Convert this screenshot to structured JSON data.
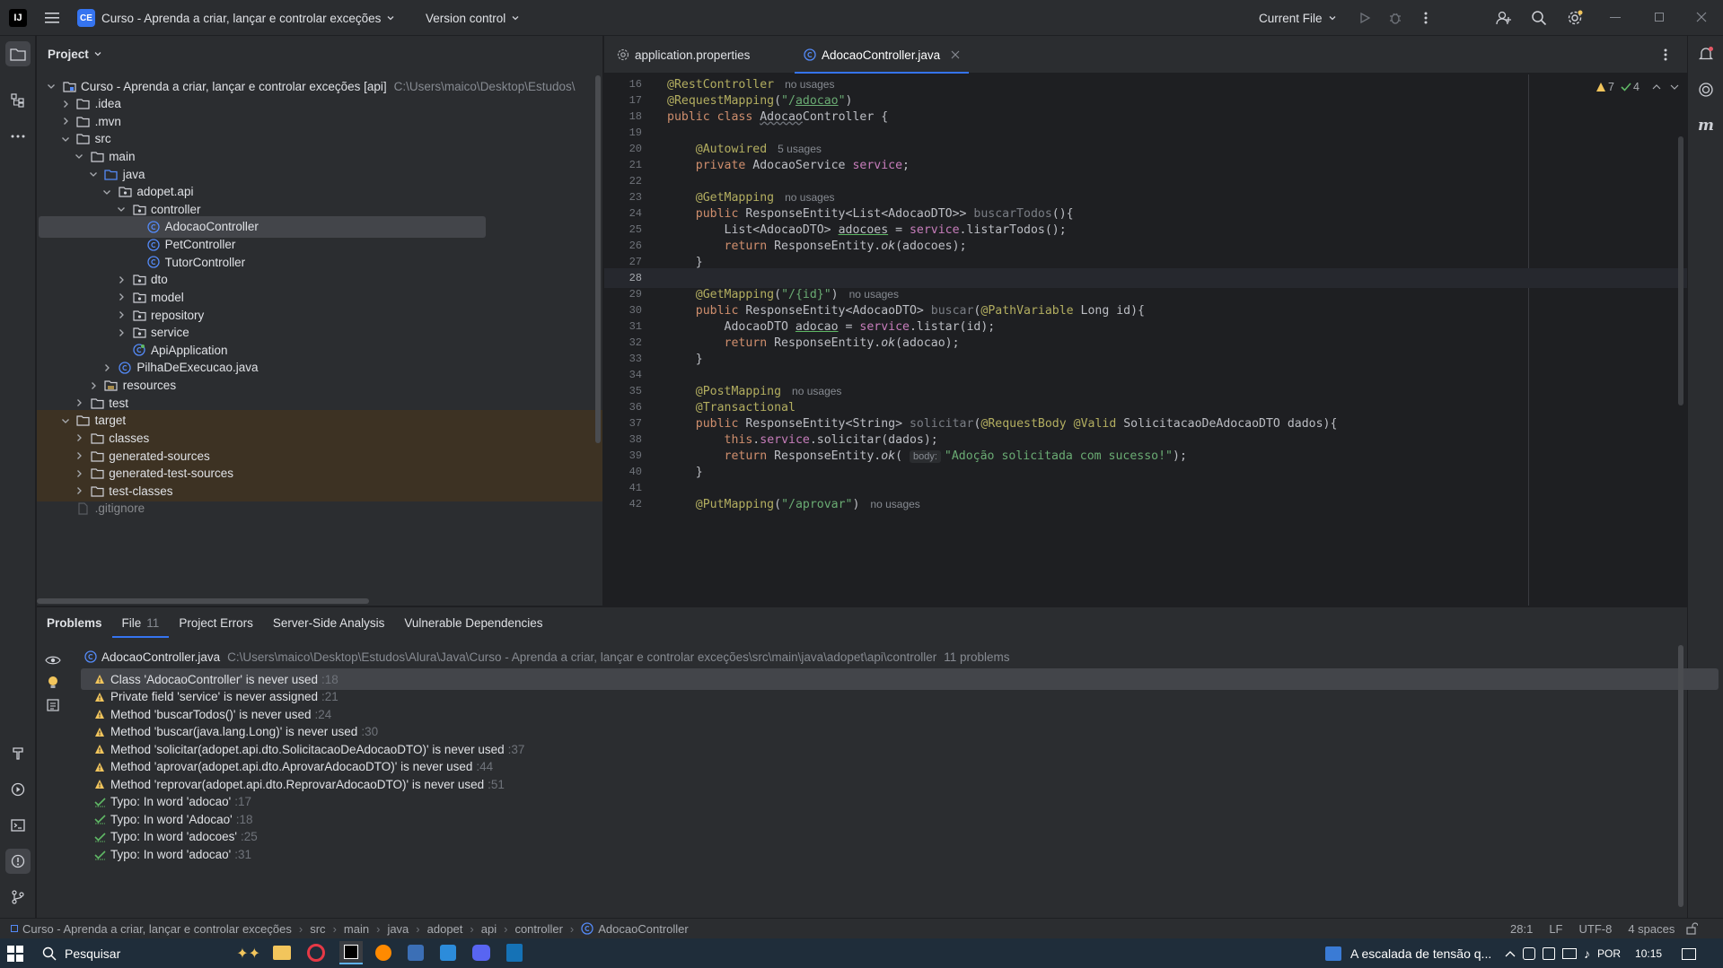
{
  "title_bar": {
    "project_badge": "CE",
    "project_name": "Curso - Aprenda a criar, lançar e controlar exceções",
    "vcs": "Version control",
    "run_config": "Current File"
  },
  "project_panel": {
    "title": "Project",
    "tree": [
      {
        "label": "Curso - Aprenda a criar, lançar e controlar exceções [api]",
        "path": "C:\\Users\\maico\\Desktop\\Estudos\\",
        "indent": 0,
        "type": "module",
        "chev": "down"
      },
      {
        "label": ".idea",
        "indent": 1,
        "type": "folder",
        "chev": "right"
      },
      {
        "label": ".mvn",
        "indent": 1,
        "type": "folder",
        "chev": "right"
      },
      {
        "label": "src",
        "indent": 1,
        "type": "folder",
        "chev": "down"
      },
      {
        "label": "main",
        "indent": 2,
        "type": "folder",
        "chev": "down"
      },
      {
        "label": "java",
        "indent": 3,
        "type": "srcfolder",
        "chev": "down"
      },
      {
        "label": "adopet.api",
        "indent": 4,
        "type": "package",
        "chev": "down"
      },
      {
        "label": "controller",
        "indent": 5,
        "type": "package",
        "chev": "down"
      },
      {
        "label": "AdocaoController",
        "indent": 6,
        "type": "class",
        "chev": "none",
        "selected": true
      },
      {
        "label": "PetController",
        "indent": 6,
        "type": "class",
        "chev": "none"
      },
      {
        "label": "TutorController",
        "indent": 6,
        "type": "class",
        "chev": "none"
      },
      {
        "label": "dto",
        "indent": 5,
        "type": "package",
        "chev": "right"
      },
      {
        "label": "model",
        "indent": 5,
        "type": "package",
        "chev": "right"
      },
      {
        "label": "repository",
        "indent": 5,
        "type": "package",
        "chev": "right"
      },
      {
        "label": "service",
        "indent": 5,
        "type": "package",
        "chev": "right"
      },
      {
        "label": "ApiApplication",
        "indent": 5,
        "type": "springclass",
        "chev": "none"
      },
      {
        "label": "PilhaDeExecucao.java",
        "indent": 4,
        "type": "class",
        "chev": "right"
      },
      {
        "label": "resources",
        "indent": 3,
        "type": "resfolder",
        "chev": "right"
      },
      {
        "label": "test",
        "indent": 2,
        "type": "folder",
        "chev": "right"
      },
      {
        "label": "target",
        "indent": 1,
        "type": "folder",
        "chev": "down",
        "excluded": true
      },
      {
        "label": "classes",
        "indent": 2,
        "type": "folder",
        "chev": "right",
        "excluded": true
      },
      {
        "label": "generated-sources",
        "indent": 2,
        "type": "folder",
        "chev": "right",
        "excluded": true
      },
      {
        "label": "generated-test-sources",
        "indent": 2,
        "type": "folder",
        "chev": "right",
        "excluded": true
      },
      {
        "label": "test-classes",
        "indent": 2,
        "type": "folder",
        "chev": "right",
        "excluded": true
      },
      {
        "label": ".gitignore",
        "indent": 1,
        "type": "file",
        "chev": "none"
      }
    ]
  },
  "editor": {
    "tabs": [
      {
        "label": "application.properties",
        "active": false
      },
      {
        "label": "AdocaoController.java",
        "active": true
      }
    ],
    "warnings_count": "7",
    "ok_count": "4",
    "current_line": 28
  },
  "problems": {
    "tabs": [
      {
        "label": "Problems",
        "count": ""
      },
      {
        "label": "File",
        "count": "11"
      },
      {
        "label": "Project Errors",
        "count": ""
      },
      {
        "label": "Server-Side Analysis",
        "count": ""
      },
      {
        "label": "Vulnerable Dependencies",
        "count": ""
      }
    ],
    "file_name": "AdocaoController.java",
    "file_path": "C:\\Users\\maico\\Desktop\\Estudos\\Alura\\Java\\Curso - Aprenda a criar, lançar e controlar exceções\\src\\main\\java\\adopet\\api\\controller",
    "file_count": "11 problems",
    "items": [
      {
        "type": "warning",
        "text": "Class 'AdocaoController' is never used",
        "line": ":18",
        "selected": true
      },
      {
        "type": "warning",
        "text": "Private field 'service' is never assigned",
        "line": ":21"
      },
      {
        "type": "warning",
        "text": "Method 'buscarTodos()' is never used",
        "line": ":24"
      },
      {
        "type": "warning",
        "text": "Method 'buscar(java.lang.Long)' is never used",
        "line": ":30"
      },
      {
        "type": "warning",
        "text": "Method 'solicitar(adopet.api.dto.SolicitacaoDeAdocaoDTO)' is never used",
        "line": ":37"
      },
      {
        "type": "warning",
        "text": "Method 'aprovar(adopet.api.dto.AprovarAdocaoDTO)' is never used",
        "line": ":44"
      },
      {
        "type": "warning",
        "text": "Method 'reprovar(adopet.api.dto.ReprovarAdocaoDTO)' is never used",
        "line": ":51"
      },
      {
        "type": "typo",
        "text": "Typo: In word 'adocao'",
        "line": ":17"
      },
      {
        "type": "typo",
        "text": "Typo: In word 'Adocao'",
        "line": ":18"
      },
      {
        "type": "typo",
        "text": "Typo: In word 'adocoes'",
        "line": ":25"
      },
      {
        "type": "typo",
        "text": "Typo: In word 'adocao'",
        "line": ":31"
      }
    ]
  },
  "status_bar": {
    "breadcrumb": [
      "Curso - Aprenda a criar, lançar e controlar exceções",
      "src",
      "main",
      "java",
      "adopet",
      "api",
      "controller",
      "AdocaoController"
    ],
    "position": "28:1",
    "line_sep": "LF",
    "encoding": "UTF-8",
    "indent": "4 spaces"
  },
  "taskbar": {
    "search_placeholder": "Pesquisar",
    "news": "A escalada de tensão q...",
    "lang": "POR",
    "time": "10:15"
  },
  "colors": {
    "accent": "#3574f0",
    "warning": "#f2c55c",
    "ok": "#5fb865",
    "excluded_bg": "#3d3223"
  }
}
